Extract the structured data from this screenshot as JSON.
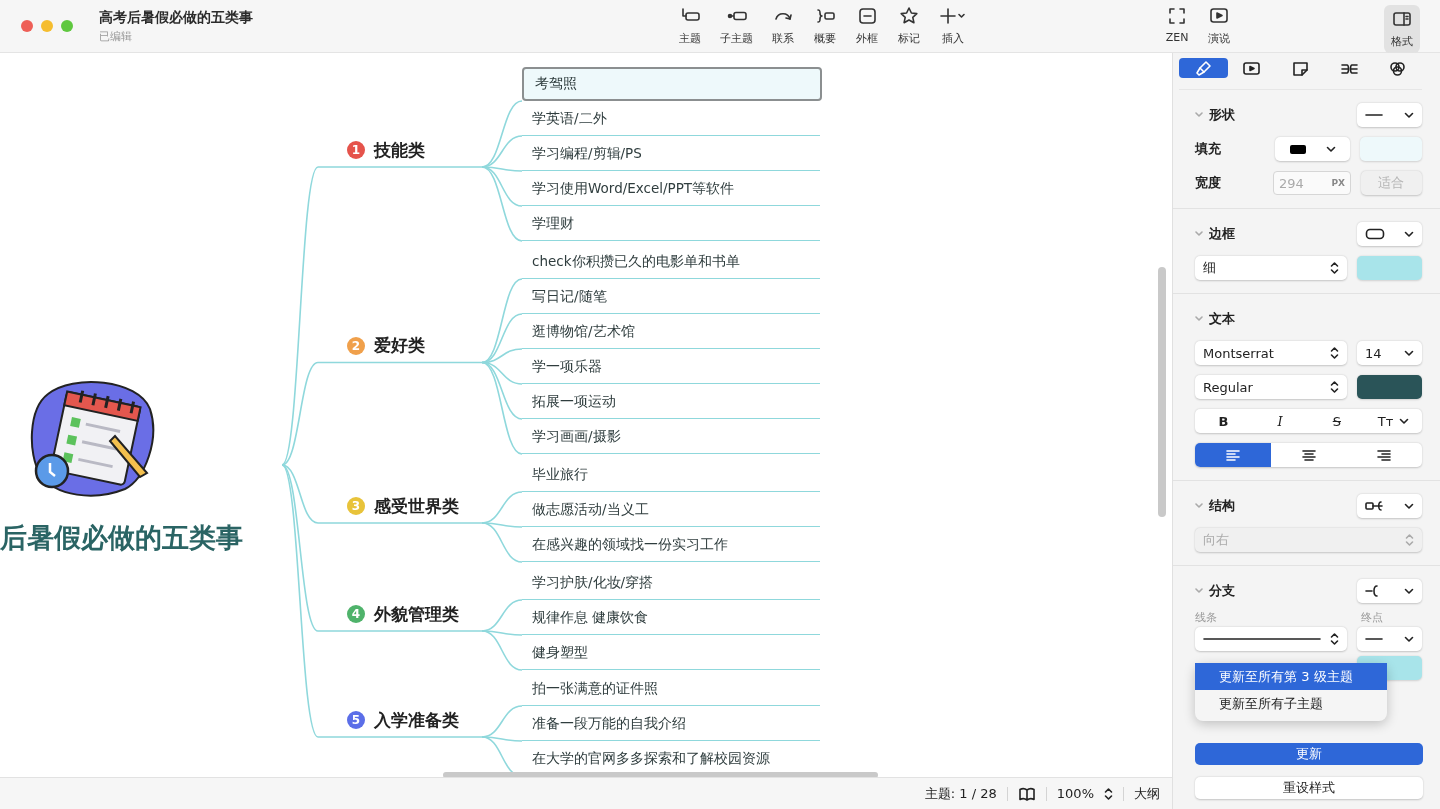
{
  "window": {
    "title": "高考后暑假必做的五类事",
    "subtitle": "已编辑"
  },
  "toolbar": {
    "tools": [
      {
        "kind": "topic",
        "label": "主题"
      },
      {
        "kind": "subtopic",
        "label": "子主题"
      },
      {
        "kind": "relation",
        "label": "联系"
      },
      {
        "kind": "summary",
        "label": "概要"
      },
      {
        "kind": "boundary",
        "label": "外框"
      },
      {
        "kind": "marker",
        "label": "标记"
      },
      {
        "kind": "insert",
        "label": "插入"
      }
    ],
    "views": [
      {
        "kind": "zen",
        "label": "ZEN"
      },
      {
        "kind": "pitch",
        "label": "演说"
      }
    ],
    "format": {
      "label": "格式",
      "selected": true
    }
  },
  "mindmap": {
    "central_topic": "后暑假必做的五类事",
    "branches": [
      {
        "number": "1",
        "color": "#e5534b",
        "title": "技能类",
        "children": [
          {
            "title": "考驾照",
            "selected": true
          },
          {
            "title": "学英语/二外",
            "selected": false
          },
          {
            "title": "学习编程/剪辑/PS",
            "selected": false
          },
          {
            "title": "学习使用Word/Excel/PPT等软件",
            "selected": false
          },
          {
            "title": "学理财",
            "selected": false
          }
        ]
      },
      {
        "number": "2",
        "color": "#f0a04b",
        "title": "爱好类",
        "children": [
          {
            "title": "check你积攒已久的电影单和书单",
            "selected": false
          },
          {
            "title": "写日记/随笔",
            "selected": false
          },
          {
            "title": "逛博物馆/艺术馆",
            "selected": false
          },
          {
            "title": "学一项乐器",
            "selected": false
          },
          {
            "title": "拓展一项运动",
            "selected": false
          },
          {
            "title": "学习画画/摄影",
            "selected": false
          }
        ]
      },
      {
        "number": "3",
        "color": "#e8c33a",
        "title": "感受世界类",
        "children": [
          {
            "title": "毕业旅行",
            "selected": false
          },
          {
            "title": "做志愿活动/当义工",
            "selected": false
          },
          {
            "title": "在感兴趣的领域找一份实习工作",
            "selected": false
          }
        ]
      },
      {
        "number": "4",
        "color": "#4fb36b",
        "title": "外貌管理类",
        "children": [
          {
            "title": "学习护肤/化妆/穿搭",
            "selected": false
          },
          {
            "title": "规律作息 健康饮食",
            "selected": false
          },
          {
            "title": "健身塑型",
            "selected": false
          }
        ]
      },
      {
        "number": "5",
        "color": "#5b6ee8",
        "title": "入学准备类",
        "children": [
          {
            "title": "拍一张满意的证件照",
            "selected": false
          },
          {
            "title": "准备一段万能的自我介绍",
            "selected": false
          },
          {
            "title": "在大学的官网多多探索和了解校园资源",
            "selected": false
          }
        ]
      }
    ]
  },
  "status_bar": {
    "topic_count": "主题: 1 / 28",
    "zoom": "100%",
    "outline": "大纲"
  },
  "panel": {
    "tabs": [
      {
        "kind": "style",
        "selected": true
      },
      {
        "kind": "slides",
        "selected": false
      },
      {
        "kind": "note",
        "selected": false
      },
      {
        "kind": "structure",
        "selected": false
      },
      {
        "kind": "theme",
        "selected": false
      }
    ],
    "shape": {
      "title": "形状",
      "fill_label": "填充",
      "width_label": "宽度",
      "width_placeholder": "294",
      "width_unit": "PX",
      "fit_button": {
        "label": "适合",
        "disabled": true
      }
    },
    "border": {
      "title": "边框",
      "weight": "细"
    },
    "text": {
      "title": "文本",
      "font": "Montserrat",
      "size": "14",
      "weight": "Regular",
      "styles": [
        {
          "kind": "bold",
          "label": "B"
        },
        {
          "kind": "italic",
          "label": "I"
        },
        {
          "kind": "strike",
          "label": "S"
        },
        {
          "kind": "case",
          "label": "Tᴛ"
        }
      ],
      "align": [
        {
          "kind": "left",
          "selected": true
        },
        {
          "kind": "center",
          "selected": false
        },
        {
          "kind": "right",
          "selected": false
        }
      ]
    },
    "structure": {
      "title": "结构",
      "direction": {
        "value": "向右",
        "disabled": true
      }
    },
    "branch": {
      "title": "分支",
      "line_label": "线条",
      "end_label": "终点"
    },
    "update_menu": [
      {
        "label": "更新至所有第 3 级主题",
        "selected": true
      },
      {
        "label": "更新至所有子主题",
        "selected": false
      }
    ],
    "buttons": [
      {
        "kind": "primary",
        "label": "更新"
      },
      {
        "kind": "secondary",
        "label": "重设样式"
      }
    ]
  }
}
